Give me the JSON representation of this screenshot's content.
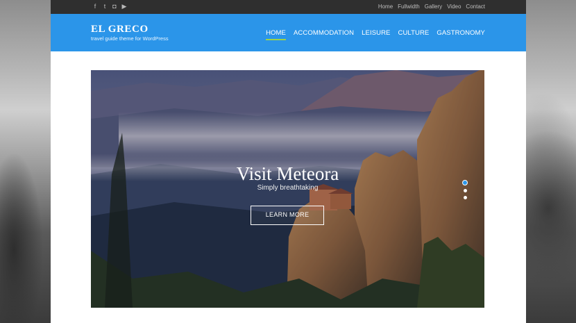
{
  "social_icons": [
    {
      "name": "facebook-icon",
      "glyph": "f"
    },
    {
      "name": "twitter-icon",
      "glyph": "t"
    },
    {
      "name": "instagram-icon",
      "glyph": "◘"
    },
    {
      "name": "youtube-icon",
      "glyph": "▶"
    }
  ],
  "topnav": {
    "items": [
      "Home",
      "Fullwidth",
      "Gallery",
      "Video",
      "Contact"
    ]
  },
  "brand": {
    "title": "EL GRECO",
    "tagline": "travel guide theme for WordPress"
  },
  "mainnav": {
    "items": [
      "HOME",
      "ACCOMMODATION",
      "LEISURE",
      "CULTURE",
      "GASTRONOMY"
    ],
    "active_index": 0
  },
  "slider": {
    "title": "Visit Meteora",
    "subtitle": "Simply breathtaking",
    "button_label": "LEARN MORE",
    "slide_count": 3,
    "active_slide": 1
  },
  "colors": {
    "header_bg": "#2b95e9",
    "topbar_bg": "#2f2f2f",
    "active_underline": "#9bd24a"
  }
}
